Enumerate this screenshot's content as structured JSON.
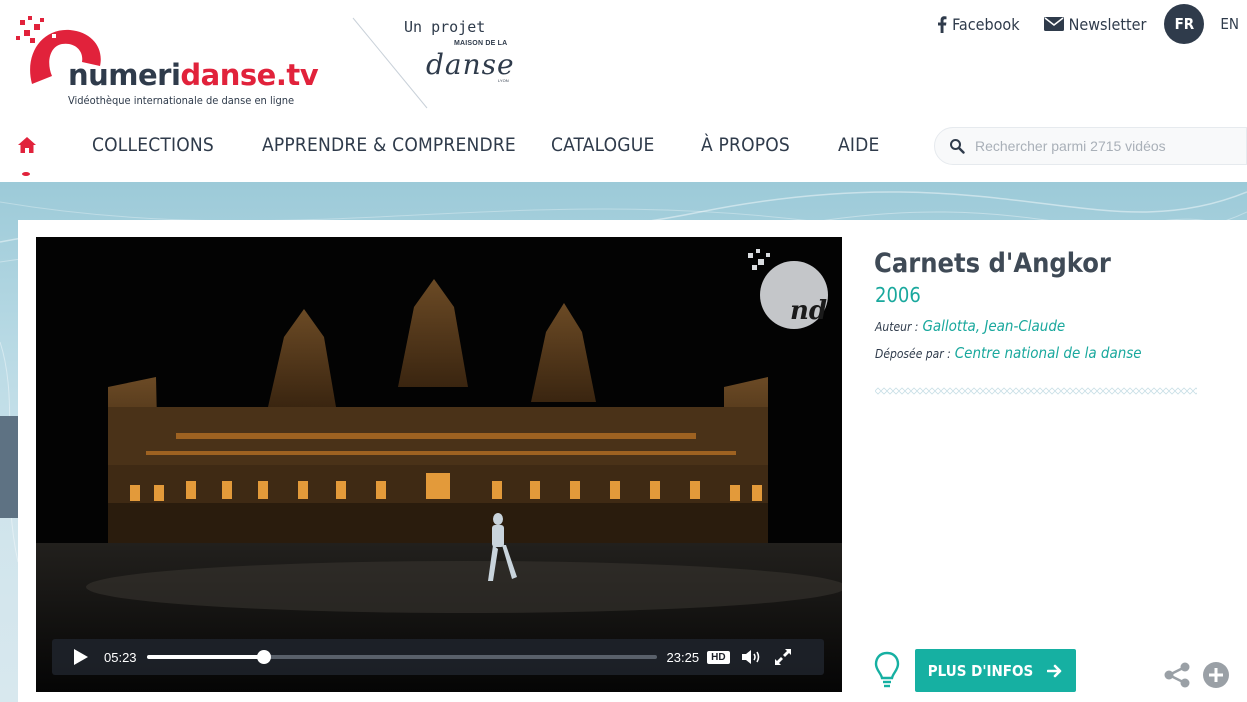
{
  "site": {
    "brand_prefix": "numeri",
    "brand_suffix": "danse.tv",
    "tagline": "Vidéothèque internationale de danse en ligne",
    "projet_text": "Un projet",
    "partner_top": "MAISON DE LA",
    "partner_name": "danse",
    "partner_city": "LYON"
  },
  "top_links": {
    "facebook": "Facebook",
    "newsletter": "Newsletter",
    "lang_active": "FR",
    "lang_other": "EN"
  },
  "nav": {
    "items": [
      "COLLECTIONS",
      "APPRENDRE & COMPRENDRE",
      "CATALOGUE",
      "À PROPOS",
      "AIDE"
    ]
  },
  "search": {
    "placeholder": "Rechercher parmi 2715 vidéos",
    "value": ""
  },
  "video": {
    "current_time": "05:23",
    "duration": "23:25",
    "progress": 0.23,
    "hd_label": "HD",
    "badge_text": "nd"
  },
  "work": {
    "title": "Carnets d'Angkor",
    "year": "2006",
    "author_label": "Auteur :",
    "author": "Gallotta, Jean-Claude",
    "deposit_label": "Déposée par :",
    "deposit": "Centre national de la danse"
  },
  "actions": {
    "more_info": "PLUS D'INFOS"
  },
  "colors": {
    "brand_red": "#e1223b",
    "navy": "#2f3b4b",
    "teal": "#16b0a2"
  },
  "icons": [
    "home-icon",
    "facebook-icon",
    "envelope-icon",
    "search-icon",
    "play-icon",
    "volume-icon",
    "fullscreen-icon",
    "lightbulb-icon",
    "arrow-right-icon",
    "share-icon",
    "plus-circle-icon"
  ]
}
